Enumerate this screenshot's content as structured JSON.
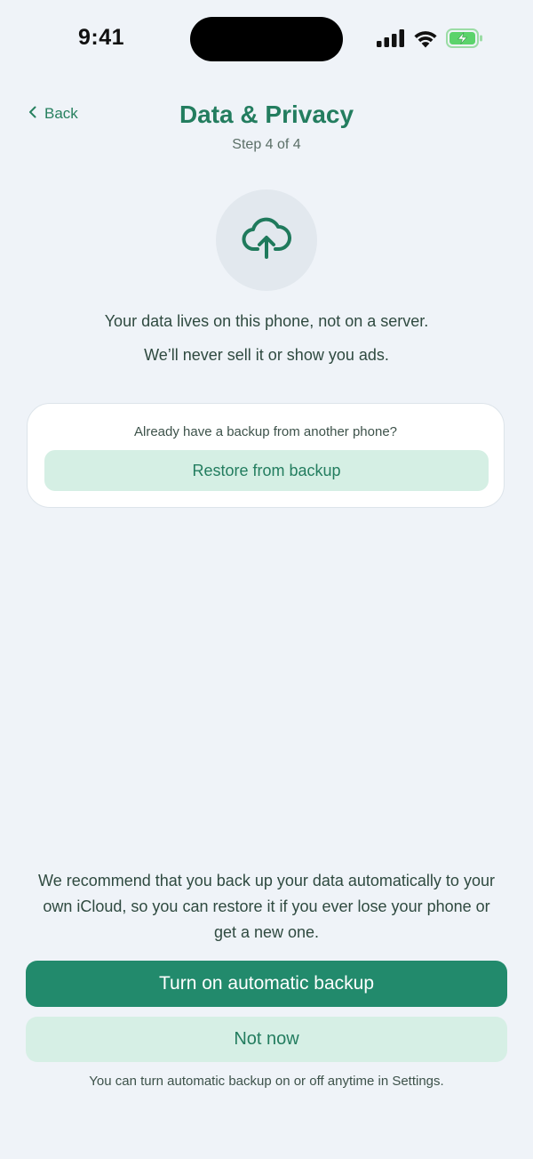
{
  "status_bar": {
    "time": "9:41",
    "icons": [
      "signal-icon",
      "wifi-icon",
      "battery-charging-icon"
    ]
  },
  "header": {
    "back_label": "Back",
    "title": "Data & Privacy",
    "step": "Step 4 of 4"
  },
  "hero": {
    "icon": "cloud-upload-icon",
    "line1": "Your data lives on this phone, not on a server.",
    "line2": "We’ll never sell it or show you ads."
  },
  "restore_card": {
    "prompt": "Already have a backup from another phone?",
    "button_label": "Restore from backup"
  },
  "footer": {
    "recommendation": "We recommend that you back up your data automatically to your own iCloud, so you can restore it if you ever lose your phone or get a new one.",
    "primary_label": "Turn on automatic backup",
    "secondary_label": "Not now",
    "note": "You can turn automatic backup on or off anytime in Settings."
  },
  "colors": {
    "accent": "#237d5f",
    "primary_button": "#228a6c",
    "soft_button": "#d6efe5",
    "background": "#eff3f8",
    "battery": "#5bd36b"
  }
}
